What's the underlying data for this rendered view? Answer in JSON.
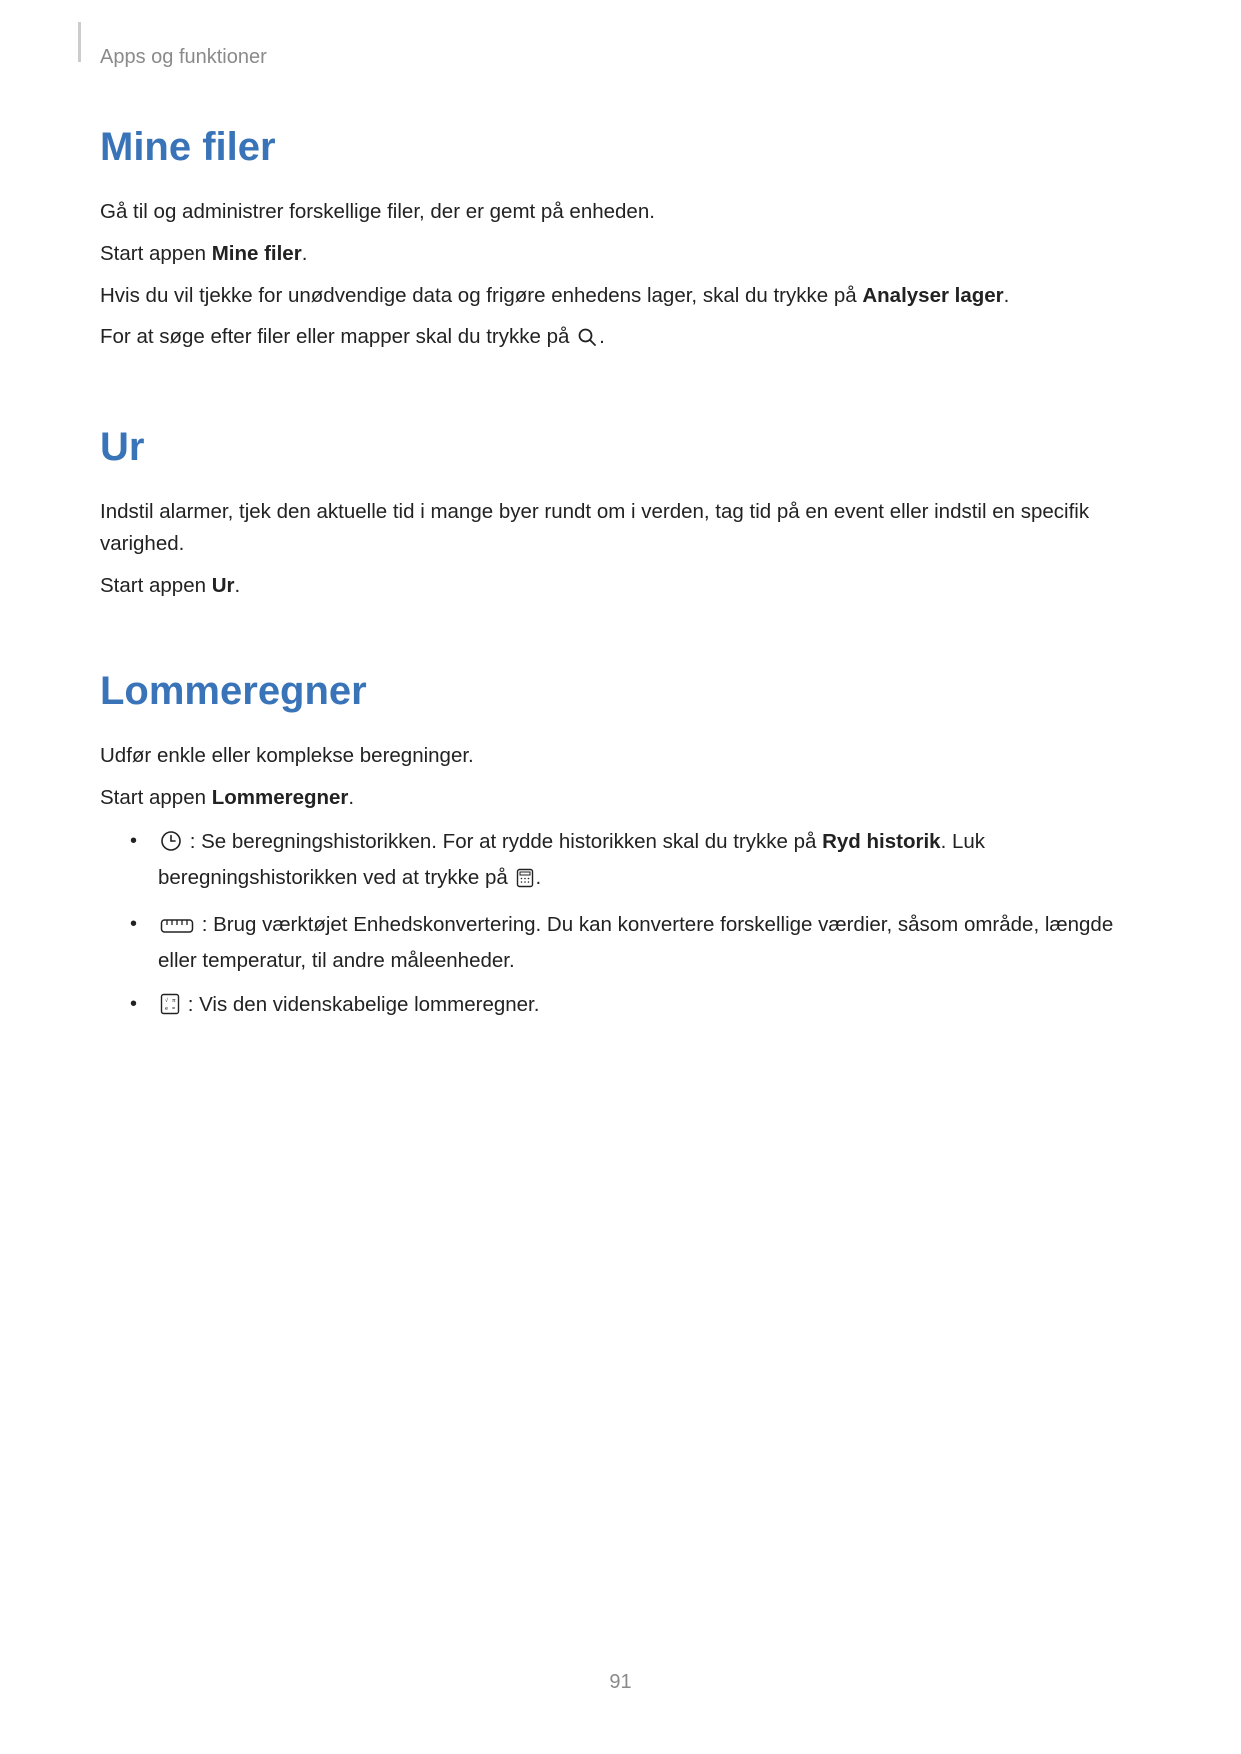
{
  "breadcrumb": "Apps og funktioner",
  "page_number": "91",
  "sections": {
    "mine_filer": {
      "title": "Mine filer",
      "p1": "Gå til og administrer forskellige filer, der er gemt på enheden.",
      "p2_pre": "Start appen ",
      "p2_bold": "Mine filer",
      "p2_post": ".",
      "p3_pre": "Hvis du vil tjekke for unødvendige data og frigøre enhedens lager, skal du trykke på ",
      "p3_bold": "Analyser lager",
      "p3_post": ".",
      "p4_pre": "For at søge efter filer eller mapper skal du trykke på ",
      "p4_post": "."
    },
    "ur": {
      "title": "Ur",
      "p1": "Indstil alarmer, tjek den aktuelle tid i mange byer rundt om i verden, tag tid på en event eller indstil en specifik varighed.",
      "p2_pre": "Start appen ",
      "p2_bold": "Ur",
      "p2_post": "."
    },
    "lommeregner": {
      "title": "Lommeregner",
      "p1": "Udfør enkle eller komplekse beregninger.",
      "p2_pre": "Start appen ",
      "p2_bold": "Lommeregner",
      "p2_post": ".",
      "bullets": {
        "b1_a": " : Se beregningshistorikken. For at rydde historikken skal du trykke på ",
        "b1_bold": "Ryd historik",
        "b1_b": ". Luk beregningshistorikken ved at trykke på ",
        "b1_c": ".",
        "b2": " : Brug værktøjet Enhedskonvertering. Du kan konvertere forskellige værdier, såsom område, længde eller temperatur, til andre måleenheder.",
        "b3": " : Vis den videnskabelige lommeregner."
      }
    }
  }
}
